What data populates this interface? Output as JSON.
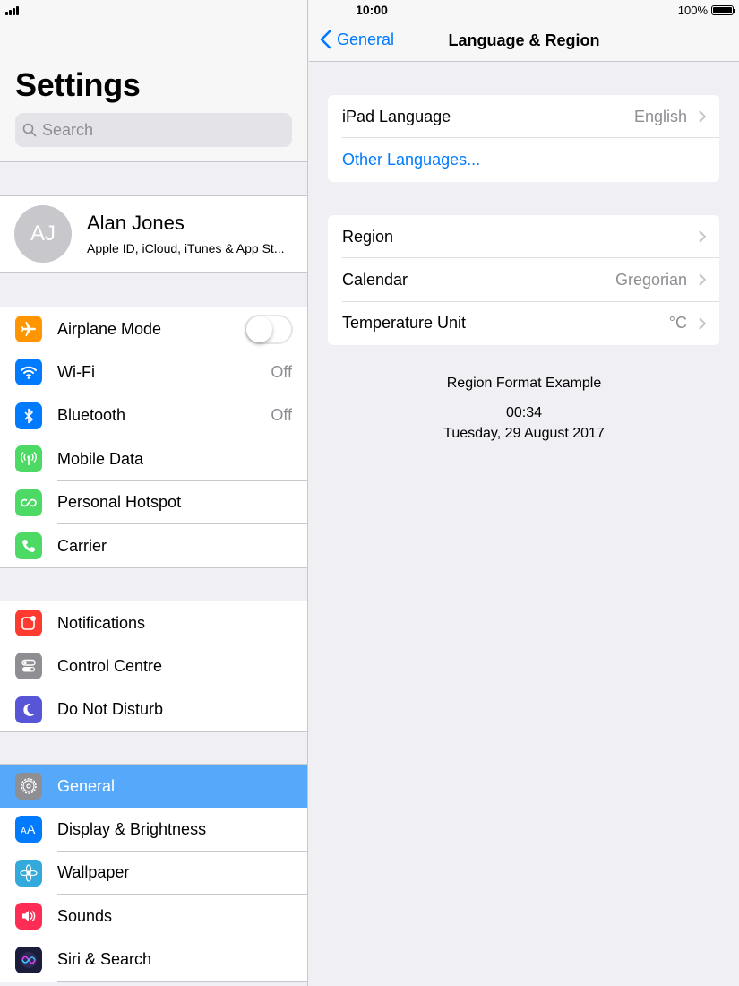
{
  "status_bar": {
    "time": "10:00",
    "battery_percent": "100%"
  },
  "sidebar": {
    "title": "Settings",
    "search_placeholder": "Search",
    "profile": {
      "initials": "AJ",
      "name": "Alan Jones",
      "subtitle": "Apple ID, iCloud, iTunes & App St..."
    },
    "groups": [
      {
        "items": [
          {
            "label": "Airplane Mode",
            "icon": "airplane-icon",
            "color": "#ff9500",
            "toggle": false
          },
          {
            "label": "Wi-Fi",
            "icon": "wifi-icon",
            "color": "#007aff",
            "value": "Off"
          },
          {
            "label": "Bluetooth",
            "icon": "bluetooth-icon",
            "color": "#007aff",
            "value": "Off"
          },
          {
            "label": "Mobile Data",
            "icon": "antenna-icon",
            "color": "#4cd964"
          },
          {
            "label": "Personal Hotspot",
            "icon": "hotspot-icon",
            "color": "#4cd964"
          },
          {
            "label": "Carrier",
            "icon": "phone-icon",
            "color": "#4cd964"
          }
        ]
      },
      {
        "items": [
          {
            "label": "Notifications",
            "icon": "notifications-icon",
            "color": "#ff3b30"
          },
          {
            "label": "Control Centre",
            "icon": "control-centre-icon",
            "color": "#8e8e93"
          },
          {
            "label": "Do Not Disturb",
            "icon": "moon-icon",
            "color": "#5856d6"
          }
        ]
      },
      {
        "items": [
          {
            "label": "General",
            "icon": "gear-icon",
            "color": "#8e8e93",
            "selected": true
          },
          {
            "label": "Display & Brightness",
            "icon": "display-brightness-icon",
            "color": "#007aff"
          },
          {
            "label": "Wallpaper",
            "icon": "wallpaper-icon",
            "color": "#34aadc"
          },
          {
            "label": "Sounds",
            "icon": "speaker-icon",
            "color": "#ff2d55"
          },
          {
            "label": "Siri & Search",
            "icon": "siri-icon",
            "color": "#1c1c3c"
          }
        ]
      }
    ]
  },
  "detail": {
    "back_label": "General",
    "title": "Language & Region",
    "section1": [
      {
        "label": "iPad Language",
        "value": "English"
      },
      {
        "label": "Other Languages...",
        "link": true
      }
    ],
    "section2": [
      {
        "label": "Region",
        "value": ""
      },
      {
        "label": "Calendar",
        "value": "Gregorian"
      },
      {
        "label": "Temperature Unit",
        "value": "°C"
      }
    ],
    "example": {
      "title": "Region Format Example",
      "time": "00:34",
      "date": "Tuesday, 29 August 2017"
    }
  },
  "colors": {
    "accent": "#007aff",
    "selected_row": "#56a9fa",
    "background": "#efeff4"
  }
}
